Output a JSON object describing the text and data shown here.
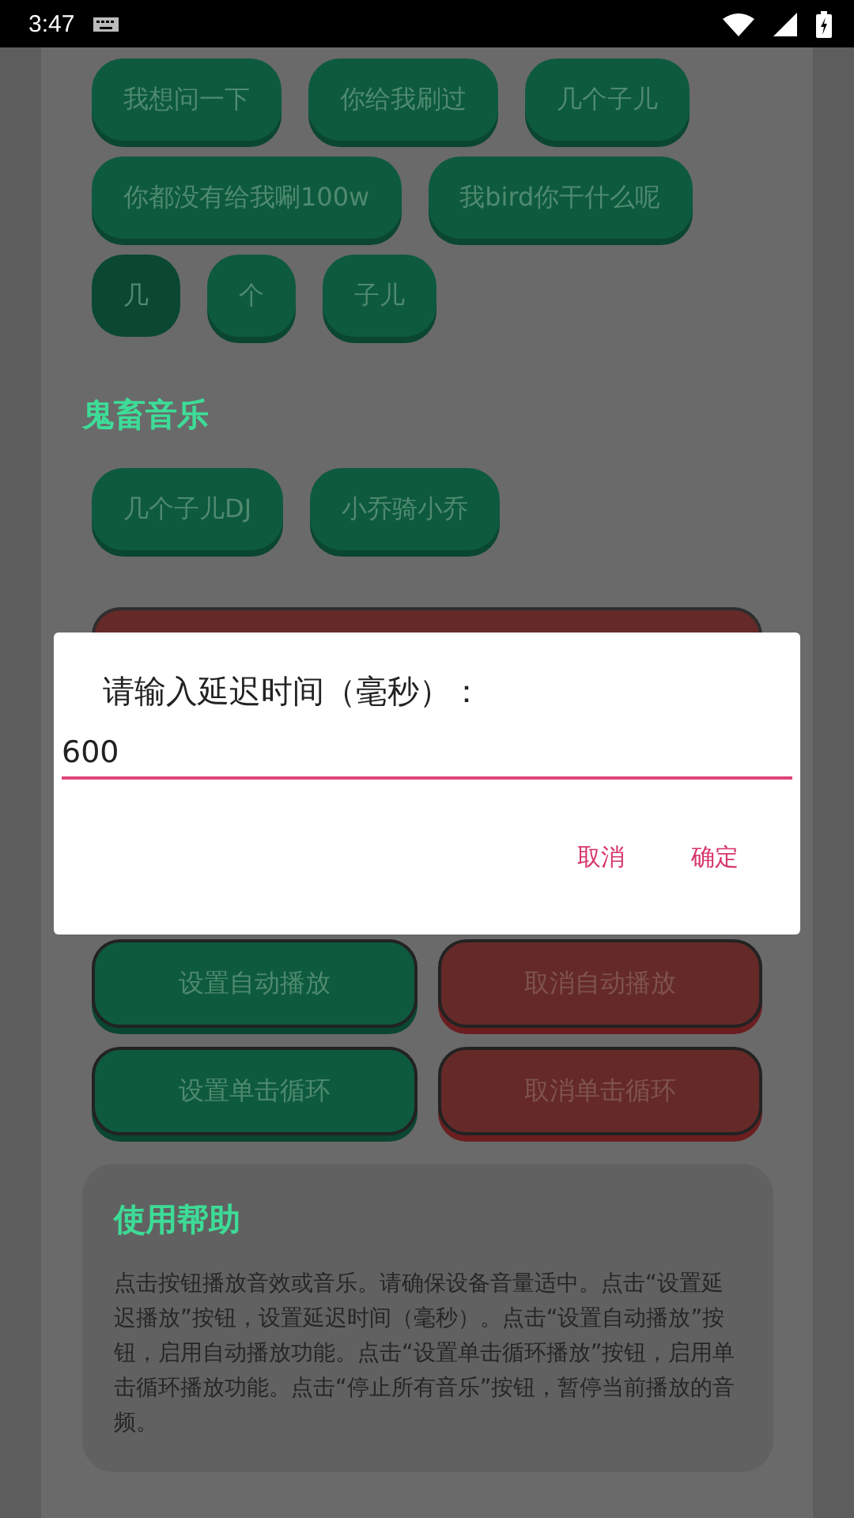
{
  "status_bar": {
    "time": "3:47"
  },
  "top_rows": [
    [
      {
        "label": "我想问一下",
        "selected": false
      },
      {
        "label": "你给我刷过",
        "selected": false
      },
      {
        "label": "几个子儿",
        "selected": false
      }
    ],
    [
      {
        "label": "你都没有给我唰100w",
        "selected": false
      },
      {
        "label": "我bird你干什么呢",
        "selected": false
      }
    ],
    [
      {
        "label": "几",
        "selected": true
      },
      {
        "label": "个",
        "selected": false
      },
      {
        "label": "子儿",
        "selected": false
      }
    ]
  ],
  "section": {
    "title": "鬼畜音乐",
    "buttons": [
      {
        "label": "几个子儿DJ",
        "selected": false
      },
      {
        "label": "小乔骑小乔",
        "selected": false
      }
    ]
  },
  "control_rows": [
    [
      {
        "label": "设置自动播放",
        "kind": "set"
      },
      {
        "label": "取消自动播放",
        "kind": "cancel"
      }
    ],
    [
      {
        "label": "设置单击循环",
        "kind": "set"
      },
      {
        "label": "取消单击循环",
        "kind": "cancel"
      }
    ]
  ],
  "help": {
    "title": "使用帮助",
    "text": "点击按钮播放音效或音乐。请确保设备音量适中。点击“设置延迟播放”按钮，设置延迟时间（毫秒）。点击“设置自动播放”按钮，启用自动播放功能。点击“设置单击循环播放”按钮，启用单击循环播放功能。点击“停止所有音乐”按钮，暂停当前播放的音频。"
  },
  "dialog": {
    "title": "请输入延迟时间（毫秒）：",
    "value": "600",
    "buttons": [
      "取消",
      "确定"
    ]
  }
}
